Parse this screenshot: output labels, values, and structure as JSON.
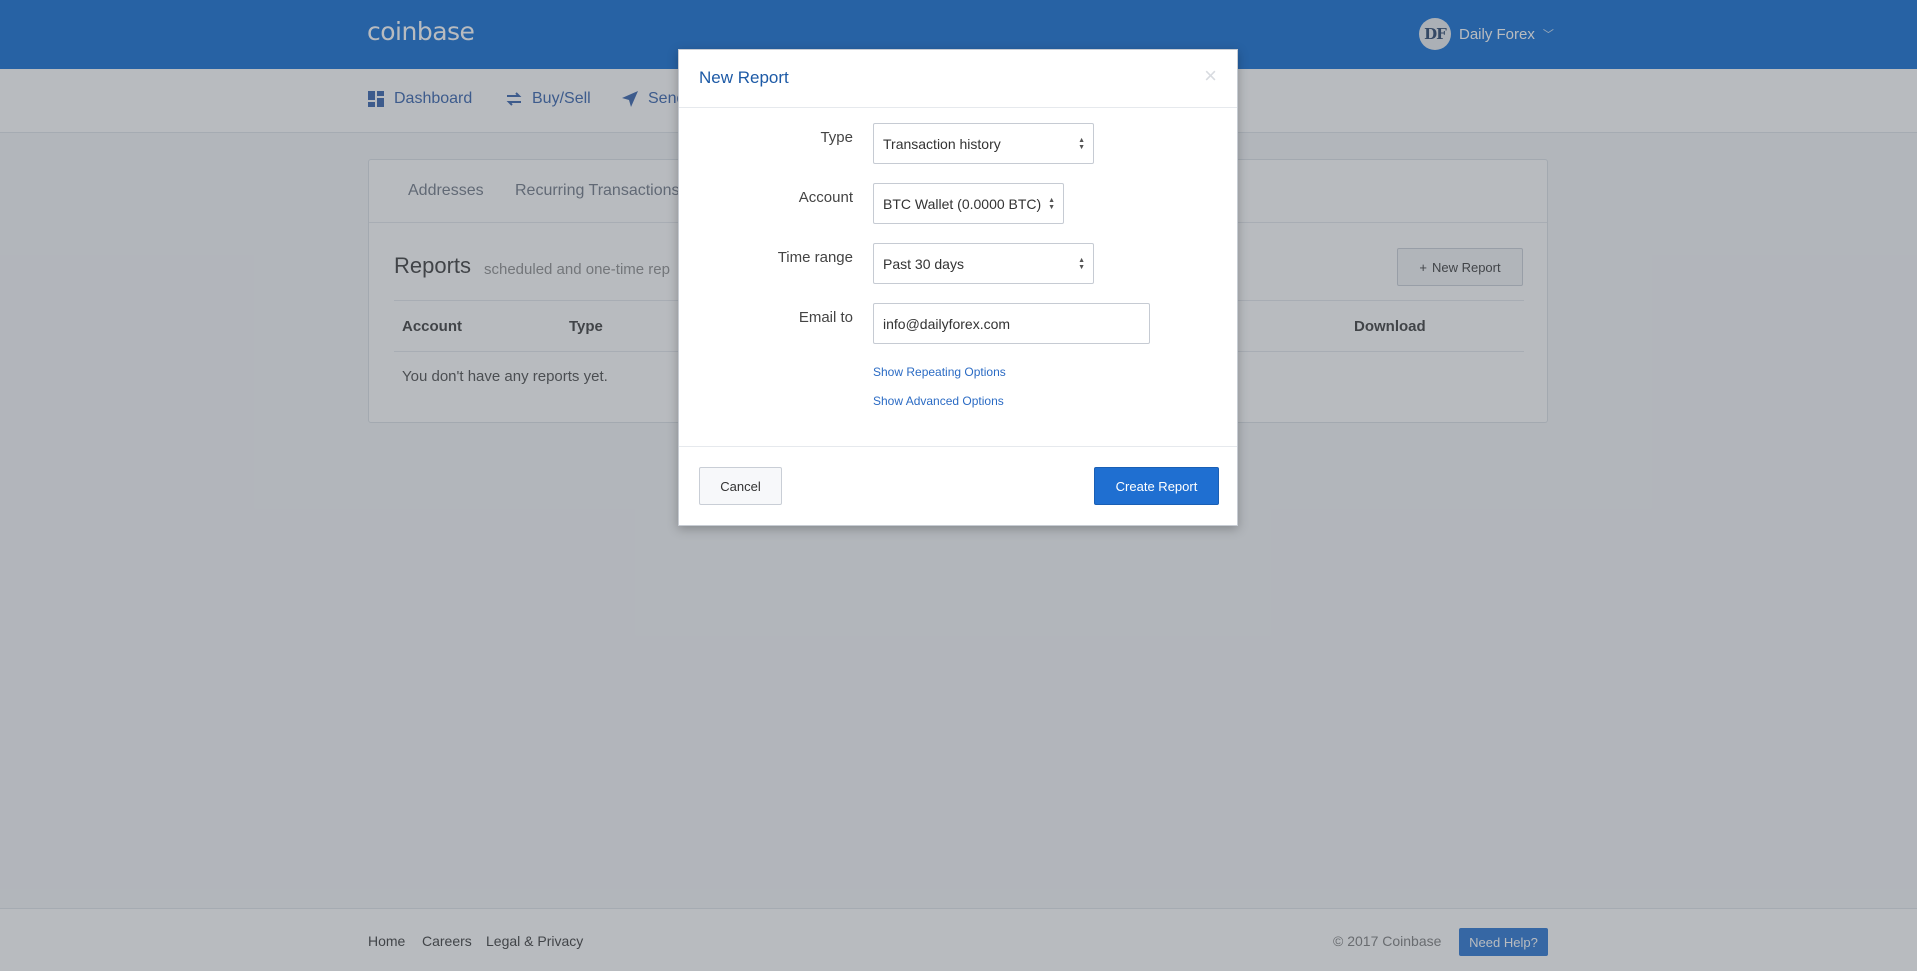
{
  "header": {
    "logo": "coinbase",
    "user_initials": "DF",
    "user_name": "Daily Forex"
  },
  "nav": {
    "items": [
      {
        "label": "Dashboard",
        "icon": "dashboard-icon"
      },
      {
        "label": "Buy/Sell",
        "icon": "exchange-icon"
      },
      {
        "label": "Send",
        "icon": "send-icon"
      }
    ]
  },
  "settings": {
    "subtabs": [
      "Addresses",
      "Recurring Transactions"
    ],
    "reports_title": "Reports",
    "reports_subtitle": "scheduled and one-time rep",
    "new_report_label": "New Report",
    "table_headers": [
      "Account",
      "Type",
      "Download"
    ],
    "empty_message": "You don't have any reports yet."
  },
  "modal": {
    "title": "New Report",
    "close_glyph": "×",
    "fields": {
      "type_label": "Type",
      "type_value": "Transaction history",
      "account_label": "Account",
      "account_value": "BTC Wallet (0.0000 BTC)",
      "time_range_label": "Time range",
      "time_range_value": "Past 30 days",
      "email_label": "Email to",
      "email_value": "info@dailyforex.com"
    },
    "show_repeating": "Show Repeating Options",
    "show_advanced": "Show Advanced Options",
    "cancel_label": "Cancel",
    "create_label": "Create Report"
  },
  "footer": {
    "links": [
      "Home",
      "Careers",
      "Legal & Privacy"
    ],
    "copyright": "© 2017 Coinbase",
    "help_label": "Need Help?"
  },
  "colors": {
    "brand_blue": "#0667d0",
    "button_blue": "#1f6fd1",
    "link_blue": "#2b6bc4"
  }
}
